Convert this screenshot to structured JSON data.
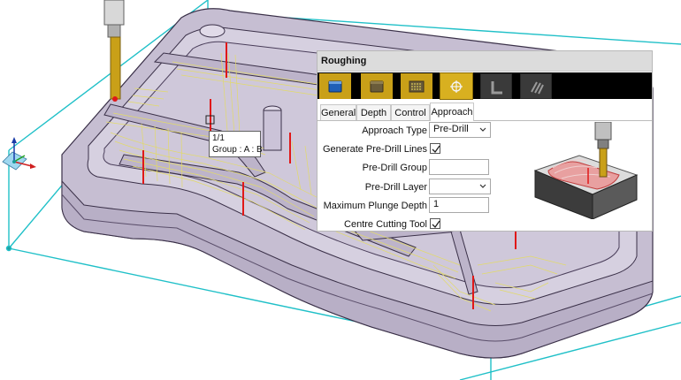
{
  "tooltip": {
    "line1": "1/1",
    "line2": "Group : A : B"
  },
  "panel": {
    "title": "Roughing",
    "toolbar": [
      {
        "icon": "block-view-icon",
        "style": "gold"
      },
      {
        "icon": "stock-block-icon",
        "style": "gold"
      },
      {
        "icon": "toolpath-preview-icon",
        "style": "gold"
      },
      {
        "icon": "crosshair-icon",
        "style": "gold-selected"
      },
      {
        "icon": "l-profile-icon",
        "style": "dark"
      },
      {
        "icon": "pattern-icon",
        "style": "dark"
      }
    ],
    "tabs": [
      "General",
      "Depth",
      "Control",
      "Approach"
    ],
    "active_tab": "Approach",
    "fields": {
      "approach_type_label": "Approach Type",
      "approach_type_value": "Pre-Drill",
      "generate_predrill_label": "Generate Pre-Drill Lines",
      "generate_predrill_checked": true,
      "predrill_group_label": "Pre-Drill Group",
      "predrill_group_value": "",
      "predrill_layer_label": "Pre-Drill Layer",
      "predrill_layer_value": "",
      "max_plunge_label": "Maximum Plunge Depth",
      "max_plunge_value": "1",
      "centre_cutting_label": "Centre Cutting Tool",
      "centre_cutting_checked": true
    }
  },
  "colors": {
    "toolbar_gold": "#c9a018",
    "bounding_box": "#20c0c8",
    "toolpath": "#e8e070",
    "plunge_line": "#e01818",
    "part_body": "#c8c0d4"
  }
}
